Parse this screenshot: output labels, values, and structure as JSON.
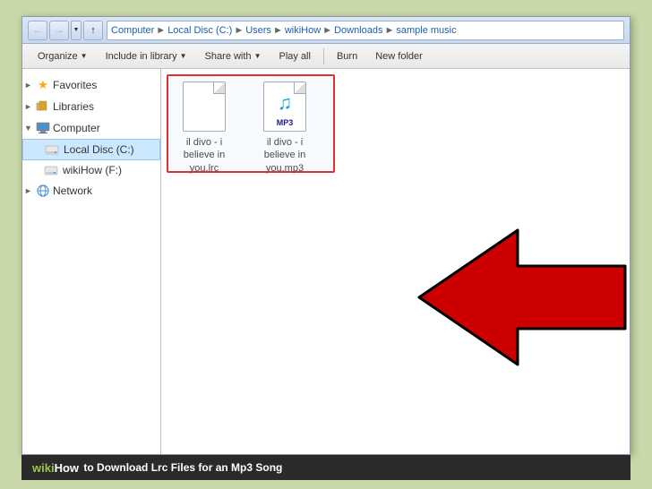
{
  "window": {
    "title": "sample music"
  },
  "breadcrumb": {
    "parts": [
      "Computer",
      "Local Disc (C:)",
      "Users",
      "wikiHow",
      "Downloads",
      "sample music"
    ]
  },
  "toolbar": {
    "organize_label": "Organize",
    "include_label": "Include in library",
    "share_label": "Share with",
    "play_label": "Play all",
    "burn_label": "Burn",
    "folder_label": "New folder"
  },
  "sidebar": {
    "favorites_label": "Favorites",
    "libraries_label": "Libraries",
    "computer_label": "Computer",
    "local_disc_label": "Local Disc (C:)",
    "wikihow_label": "wikiHow (F:)",
    "network_label": "Network"
  },
  "files": [
    {
      "name": "il divo - i believe\nin you.lrc",
      "type": "lrc",
      "icon": "generic"
    },
    {
      "name": "il divo - i believe\nin you.mp3",
      "type": "mp3",
      "icon": "mp3"
    }
  ],
  "wikihow": {
    "wiki_part": "wiki",
    "how_part": "How",
    "tagline": "to Download Lrc Files for an Mp3 Song"
  }
}
